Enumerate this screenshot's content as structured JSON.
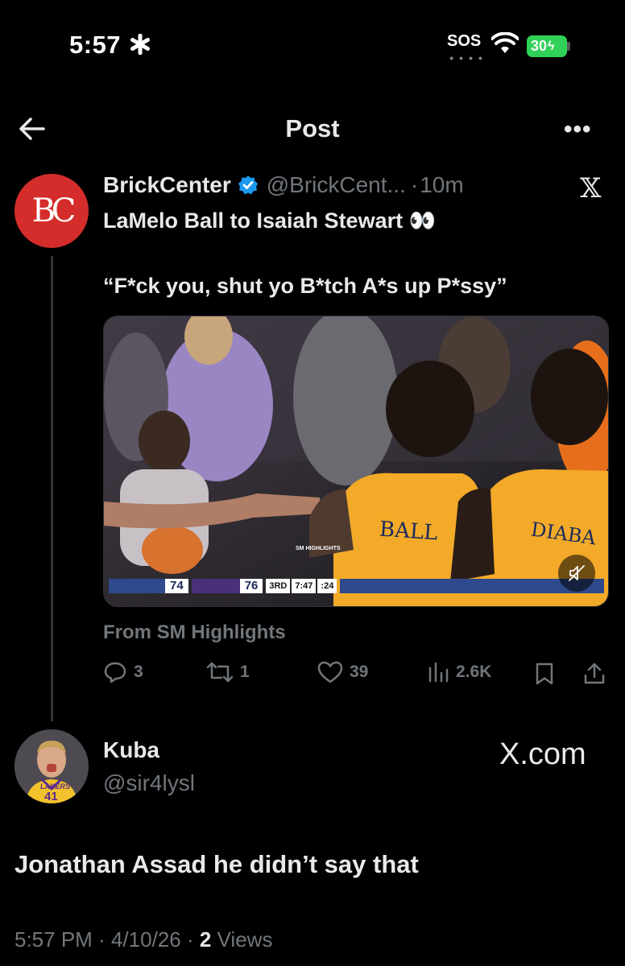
{
  "status_bar": {
    "time": "5:57",
    "carrier": "SOS",
    "battery": "30"
  },
  "header": {
    "title": "Post"
  },
  "tweet": {
    "author_name": "BrickCenter",
    "handle": "@BrickCent...",
    "separator": "·",
    "time_ago": "10m",
    "avatar_text": "BC",
    "text": "LaMelo Ball to Isaiah Stewart 👀",
    "quote": "“F*ck you, shut yo B*tch A*s up P*ssy”",
    "media": {
      "watermark": "SM HIGHLIGHTS",
      "jersey_left": "BALL",
      "jersey_right": "DIABA",
      "score_home": "74",
      "score_away": "76",
      "quarter": "3RD",
      "clock": "7:47",
      "shot_clock": ":24"
    },
    "from": "From SM Highlights",
    "actions": {
      "replies": "3",
      "reposts": "1",
      "likes": "39",
      "views": "2.6K"
    }
  },
  "reply": {
    "name": "Kuba",
    "handle": "@sir4lysl",
    "jersey_team": "LAKERS",
    "jersey_number": "41",
    "text": "Jonathan Assad he didn’t say that",
    "time": "5:57 PM",
    "date": "4/10/26",
    "separator": "·",
    "views_count": "2",
    "views_label": "Views"
  },
  "brand": {
    "xcom": "X.com"
  },
  "colors": {
    "background": "#000000",
    "muted": "#71767b",
    "verified": "#1d9bf0",
    "avatar_red": "#d42d2b",
    "battery": "#30d158"
  }
}
